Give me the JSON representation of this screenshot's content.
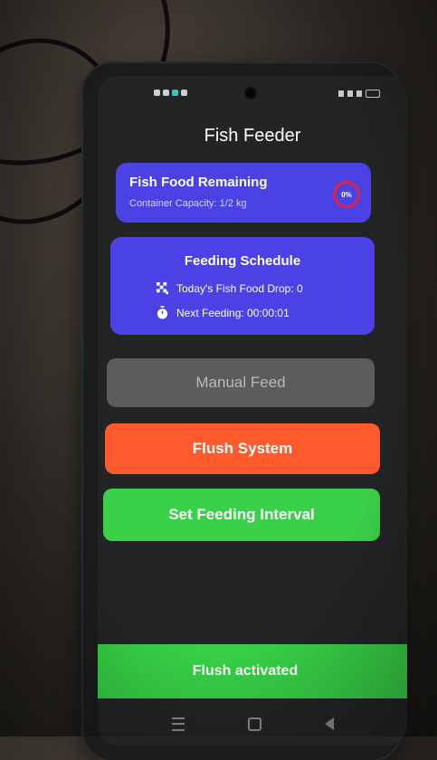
{
  "app": {
    "title": "Fish Feeder"
  },
  "food_card": {
    "title": "Fish Food Remaining",
    "subtitle": "Container Capacity: 1/2 kg",
    "percent_label": "0%",
    "percent_value": 0
  },
  "schedule_card": {
    "title": "Feeding Schedule",
    "drop_label": "Today's Fish Food Drop: 0",
    "next_label": "Next Feeding: 00:00:01",
    "drop_icon": "checkered-icon",
    "timer_icon": "stopwatch-icon"
  },
  "buttons": {
    "manual_feed": "Manual Feed",
    "flush_system": "Flush System",
    "set_interval": "Set Feeding Interval"
  },
  "toast": {
    "message": "Flush activated"
  },
  "colors": {
    "card": "#4b42e6",
    "manual": "#5c5c5e",
    "flush": "#ff5a2c",
    "interval": "#3bd04a",
    "gauge_ring": "#e0243f",
    "toast": "#37d046"
  },
  "navbar": {
    "icons": [
      "recents-icon",
      "home-icon",
      "back-icon"
    ]
  }
}
